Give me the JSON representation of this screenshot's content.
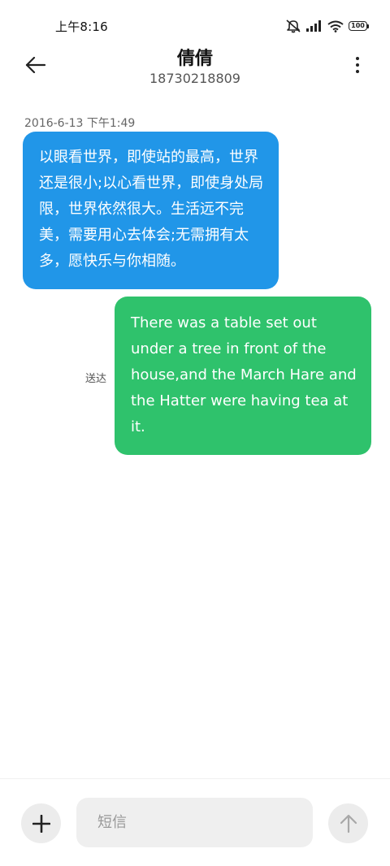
{
  "status_bar": {
    "time": "上午8:16",
    "battery": "100",
    "icons": [
      "mute-icon",
      "signal-icon",
      "wifi-icon",
      "battery-icon"
    ]
  },
  "header": {
    "contact_name": "倩倩",
    "phone_number": "18730218809",
    "back_icon": "back-arrow-icon",
    "more_icon": "more-vertical-icon"
  },
  "conversation": {
    "timestamp": "2016-6-13 下午1:49",
    "messages": [
      {
        "direction": "incoming",
        "text": "以眼看世界，即使站的最高，世界还是很小;以心看世界，即使身处局限，世界依然很大。生活远不完美，需要用心去体会;无需拥有太多，愿快乐与你相随。",
        "color": "#2196e8"
      },
      {
        "direction": "outgoing",
        "text": "There was a table set out under a tree in front of the house,and the March Hare and the Hatter were having tea at it.",
        "status": "送达",
        "color": "#2fc26c"
      }
    ]
  },
  "composer": {
    "placeholder": "短信",
    "add_icon": "plus-icon",
    "send_icon": "send-arrow-up-icon"
  }
}
